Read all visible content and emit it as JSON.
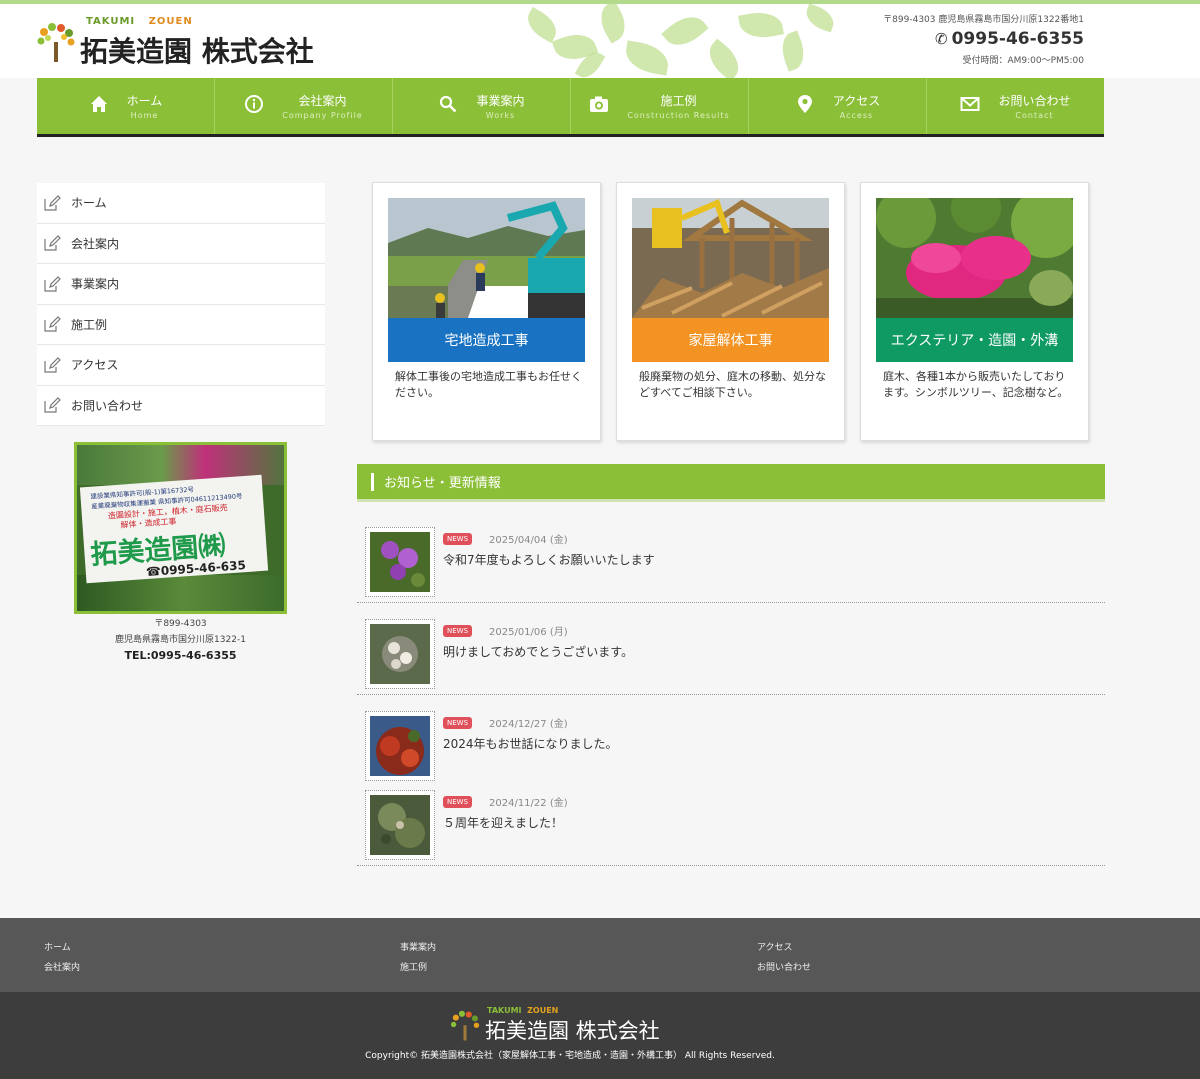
{
  "brand": {
    "name_en_1": "TAKUMI",
    "name_en_2": "ZOUEN",
    "name_jp": "拓美造園 株式会社"
  },
  "header": {
    "address": "〒899-4303 鹿児島県霧島市国分川原1322番地1",
    "tel": "0995-46-6355",
    "hours": "受付時間：AM9:00〜PM5:00"
  },
  "nav": [
    {
      "label": "ホーム",
      "sub": "Home",
      "icon": "home-icon"
    },
    {
      "label": "会社案内",
      "sub": "Company Profile",
      "icon": "info-icon"
    },
    {
      "label": "事業案内",
      "sub": "Works",
      "icon": "search-icon"
    },
    {
      "label": "施工例",
      "sub": "Construction Results",
      "icon": "camera-icon"
    },
    {
      "label": "アクセス",
      "sub": "Access",
      "icon": "map-pin-icon"
    },
    {
      "label": "お問い合わせ",
      "sub": "Contact",
      "icon": "mail-icon"
    }
  ],
  "sidebar": {
    "items": [
      "ホーム",
      "会社案内",
      "事業案内",
      "施工例",
      "アクセス",
      "お問い合わせ"
    ],
    "sign": {
      "line1": "建設業県知事許可(般-1)第16732号",
      "line2": "産業廃棄物収集運搬業 県知事許可04611213490号",
      "line3": "造園設計・施工，植木・庭石販売",
      "line4": "解体・造成工事",
      "name": "拓美造園㈱",
      "tel": "☎0995-46-635"
    },
    "postal": "〒899-4303",
    "address": "鹿児島県霧島市国分川原1322-1",
    "tel": "TEL:0995-46-6355"
  },
  "cards": [
    {
      "title": "宅地造成工事",
      "text": "解体工事後の宅地造成工事もお任せください。",
      "color": "#1a73c2"
    },
    {
      "title": "家屋解体工事",
      "text": "般廃棄物の処分、庭木の移動、処分などすべてご相談下さい。",
      "color": "#f39323"
    },
    {
      "title": "エクステリア・造園・外溝",
      "text": "庭木、各種1本から販売いたしております。シンボルツリー、記念樹など。",
      "color": "#0f9a64"
    }
  ],
  "news": {
    "heading": "お知らせ・更新情報",
    "items": [
      {
        "badge": "NEWS",
        "date": "2025/04/04 (金)",
        "title": "令和7年度もよろしくお願いいたします"
      },
      {
        "badge": "NEWS",
        "date": "2025/01/06 (月)",
        "title": "明けましておめでとうございます。"
      },
      {
        "badge": "NEWS",
        "date": "2024/12/27 (金)",
        "title": "2024年もお世話になりました。"
      },
      {
        "badge": "NEWS",
        "date": "2024/11/22 (金)",
        "title": "５周年を迎えました！"
      }
    ]
  },
  "footer": {
    "links_col1": [
      "ホーム",
      "会社案内"
    ],
    "links_col2": [
      "事業案内",
      "施工例"
    ],
    "links_col3": [
      "アクセス",
      "お問い合わせ"
    ],
    "copyright": "Copyright© 拓美造園株式会社（家屋解体工事・宅地造成・造園・外構工事） All Rights Reserved."
  },
  "colors": {
    "accent": "#8cbf38",
    "badge": "#e0505a"
  }
}
